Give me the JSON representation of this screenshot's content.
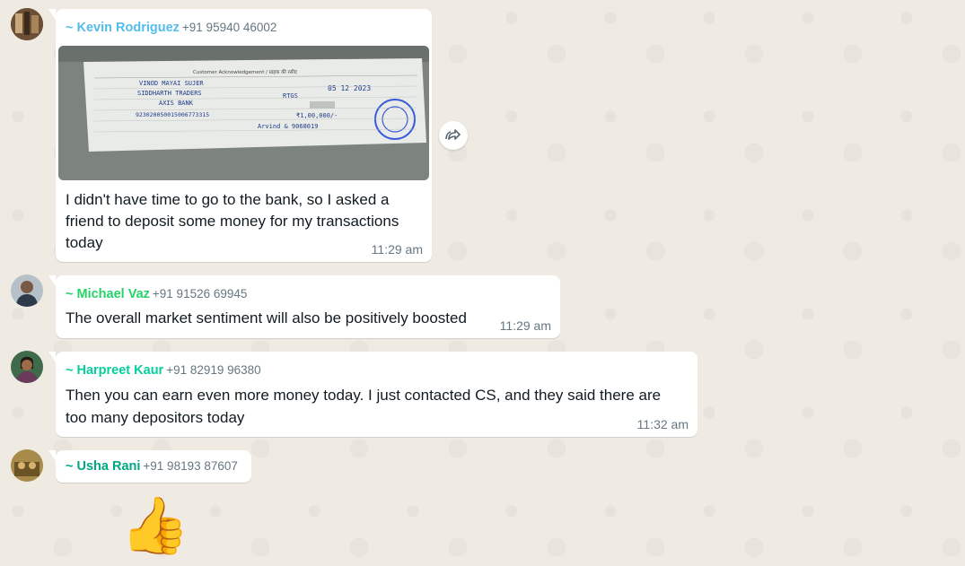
{
  "messages": [
    {
      "sender": "~ Kevin Rodriguez",
      "phone": "+91 95940 46002",
      "name_color": "#53bdeb",
      "text_lines": [
        "I didn't have time to go to the bank, so I asked a",
        "friend to deposit some money for my transactions",
        "today"
      ],
      "time": "11:29 am",
      "has_image": true,
      "receipt": {
        "heading": "Customer Acknowledgement / ग्राहक की रसीद",
        "name": "VINOD MAYAI SUJER",
        "beneficiary": "SIDDHARTH TRADERS",
        "bank": "AXIS BANK",
        "account": "923020050015006773315",
        "date": "05 12 2023",
        "mode": "RTGS",
        "amount": "₹1,00,000/-",
        "signature": "Arvind & 9068019"
      }
    },
    {
      "sender": "~ Michael Vaz",
      "phone": "+91 91526 69945",
      "name_color": "#25d366",
      "text_lines": [
        "The overall market sentiment will also be positively boosted"
      ],
      "time": "11:29 am"
    },
    {
      "sender": "~ Harpreet Kaur",
      "phone": "+91 82919 96380",
      "name_color": "#06cf9c",
      "text_lines": [
        "Then you can earn even more money today. I just contacted CS, and they said there are",
        "too many depositors today"
      ],
      "time": "11:32 am"
    },
    {
      "sender": "~ Usha Rani",
      "phone": "+91 98193 87607",
      "name_color": "#00a884",
      "emoji": "👍"
    }
  ],
  "icons": {
    "forward": "forward-icon"
  }
}
